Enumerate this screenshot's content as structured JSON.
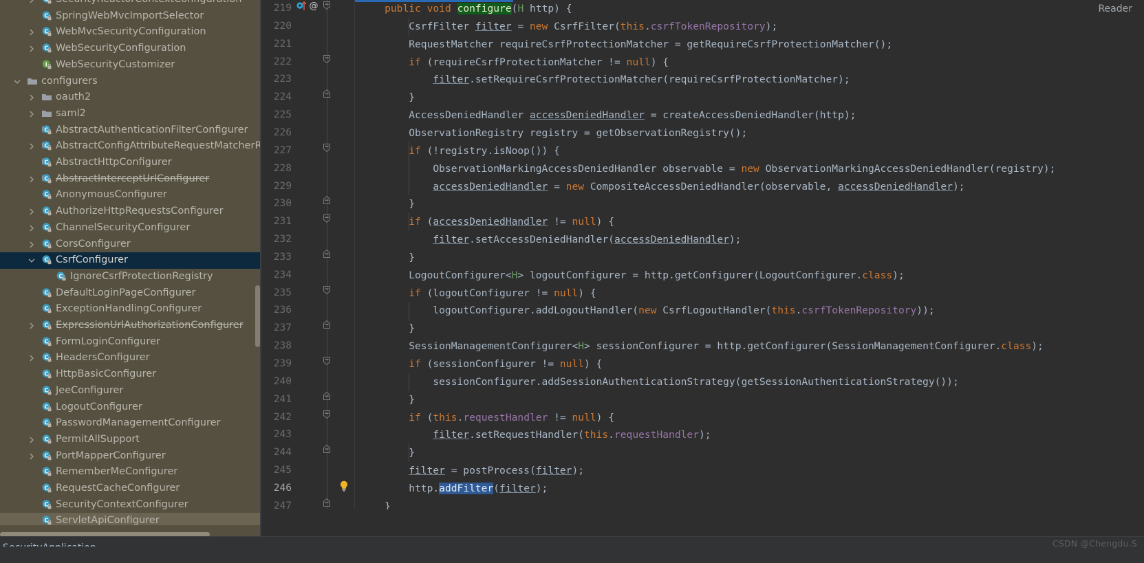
{
  "window": {
    "reader_label": "Reader",
    "watermark": "CSDN @Chengdu.S",
    "bottom_breadcrumb": "SecurityApplication"
  },
  "sidebar": {
    "scrollbar_h": "horizontal-scrollbar",
    "scrollbar_v": "vertical-scrollbar",
    "items": [
      {
        "label": "SecurityReactorContextConfiguration",
        "icon": "class-icon",
        "indent": 2,
        "arrow": "right",
        "state": "partial"
      },
      {
        "label": "SpringWebMvcImportSelector",
        "icon": "class-icon",
        "indent": 2,
        "arrow": "none"
      },
      {
        "label": "WebMvcSecurityConfiguration",
        "icon": "class-icon",
        "indent": 2,
        "arrow": "right"
      },
      {
        "label": "WebSecurityConfiguration",
        "icon": "class-icon",
        "indent": 2,
        "arrow": "right"
      },
      {
        "label": "WebSecurityCustomizer",
        "icon": "interface-icon",
        "indent": 2,
        "arrow": "none"
      },
      {
        "label": "configurers",
        "icon": "folder-icon",
        "indent": 1,
        "arrow": "down"
      },
      {
        "label": "oauth2",
        "icon": "folder-icon",
        "indent": 2,
        "arrow": "right"
      },
      {
        "label": "saml2",
        "icon": "folder-icon",
        "indent": 2,
        "arrow": "right"
      },
      {
        "label": "AbstractAuthenticationFilterConfigurer",
        "icon": "abstract-class-icon",
        "indent": 2,
        "arrow": "none"
      },
      {
        "label": "AbstractConfigAttributeRequestMatcherRegistry",
        "icon": "abstract-class-icon",
        "indent": 2,
        "arrow": "right"
      },
      {
        "label": "AbstractHttpConfigurer",
        "icon": "abstract-class-icon",
        "indent": 2,
        "arrow": "none"
      },
      {
        "label": "AbstractInterceptUrlConfigurer",
        "icon": "abstract-class-icon",
        "indent": 2,
        "arrow": "right",
        "deprecated": true
      },
      {
        "label": "AnonymousConfigurer",
        "icon": "class-icon",
        "indent": 2,
        "arrow": "none"
      },
      {
        "label": "AuthorizeHttpRequestsConfigurer",
        "icon": "class-icon",
        "indent": 2,
        "arrow": "right"
      },
      {
        "label": "ChannelSecurityConfigurer",
        "icon": "class-icon",
        "indent": 2,
        "arrow": "right"
      },
      {
        "label": "CorsConfigurer",
        "icon": "class-icon",
        "indent": 2,
        "arrow": "right"
      },
      {
        "label": "CsrfConfigurer",
        "icon": "class-icon",
        "indent": 2,
        "arrow": "down",
        "selected": true
      },
      {
        "label": "IgnoreCsrfProtectionRegistry",
        "icon": "class-icon",
        "indent": 3,
        "arrow": "none"
      },
      {
        "label": "DefaultLoginPageConfigurer",
        "icon": "class-icon",
        "indent": 2,
        "arrow": "none"
      },
      {
        "label": "ExceptionHandlingConfigurer",
        "icon": "class-icon",
        "indent": 2,
        "arrow": "none"
      },
      {
        "label": "ExpressionUrlAuthorizationConfigurer",
        "icon": "class-icon",
        "indent": 2,
        "arrow": "right",
        "deprecated": true
      },
      {
        "label": "FormLoginConfigurer",
        "icon": "class-icon",
        "indent": 2,
        "arrow": "none"
      },
      {
        "label": "HeadersConfigurer",
        "icon": "class-icon",
        "indent": 2,
        "arrow": "right"
      },
      {
        "label": "HttpBasicConfigurer",
        "icon": "class-icon",
        "indent": 2,
        "arrow": "none"
      },
      {
        "label": "JeeConfigurer",
        "icon": "class-icon",
        "indent": 2,
        "arrow": "none"
      },
      {
        "label": "LogoutConfigurer",
        "icon": "class-icon",
        "indent": 2,
        "arrow": "none"
      },
      {
        "label": "PasswordManagementConfigurer",
        "icon": "class-icon",
        "indent": 2,
        "arrow": "none"
      },
      {
        "label": "PermitAllSupport",
        "icon": "class-icon",
        "indent": 2,
        "arrow": "right"
      },
      {
        "label": "PortMapperConfigurer",
        "icon": "class-icon",
        "indent": 2,
        "arrow": "right"
      },
      {
        "label": "RememberMeConfigurer",
        "icon": "class-icon",
        "indent": 2,
        "arrow": "none"
      },
      {
        "label": "RequestCacheConfigurer",
        "icon": "class-icon",
        "indent": 2,
        "arrow": "none"
      },
      {
        "label": "SecurityContextConfigurer",
        "icon": "class-icon",
        "indent": 2,
        "arrow": "none"
      },
      {
        "label": "ServletApiConfigurer",
        "icon": "class-icon",
        "indent": 2,
        "arrow": "none",
        "ghost": true
      }
    ]
  },
  "editor": {
    "first_line_number": 219,
    "current_line_number": 246,
    "gutter_icons": {
      "override_method": "override-method-icon",
      "annotation": "annotation-icon",
      "intention_bulb": "intention-bulb-icon"
    },
    "find_highlight": "configure",
    "selection_highlight": "addFilter",
    "lines": [
      {
        "n": 219,
        "indent": 4,
        "fold": "start",
        "marks": [
          "override",
          "at"
        ],
        "tokens": [
          {
            "t": "public ",
            "c": "kw"
          },
          {
            "t": "void ",
            "c": "kw"
          },
          {
            "t": "configure",
            "c": "hl-find"
          },
          {
            "t": "(",
            "c": "plain"
          },
          {
            "t": "H",
            "c": "gen"
          },
          {
            "t": " http) {",
            "c": "plain"
          }
        ]
      },
      {
        "n": 220,
        "indent": 8,
        "tokens": [
          {
            "t": "CsrfFilter ",
            "c": "typ"
          },
          {
            "t": "filter",
            "c": "loc"
          },
          {
            "t": " = ",
            "c": "plain"
          },
          {
            "t": "new ",
            "c": "kw"
          },
          {
            "t": "CsrfFilter(",
            "c": "typ"
          },
          {
            "t": "this",
            "c": "kw"
          },
          {
            "t": ".",
            "c": "plain"
          },
          {
            "t": "csrfTokenRepository",
            "c": "fld"
          },
          {
            "t": ");",
            "c": "plain"
          }
        ]
      },
      {
        "n": 221,
        "indent": 8,
        "tokens": [
          {
            "t": "RequestMatcher requireCsrfProtectionMatcher = getRequireCsrfProtectionMatcher();",
            "c": "plain"
          }
        ]
      },
      {
        "n": 222,
        "indent": 8,
        "fold": "start",
        "tokens": [
          {
            "t": "if ",
            "c": "kw"
          },
          {
            "t": "(requireCsrfProtectionMatcher != ",
            "c": "plain"
          },
          {
            "t": "null",
            "c": "kw"
          },
          {
            "t": ") {",
            "c": "plain"
          }
        ]
      },
      {
        "n": 223,
        "indent": 12,
        "tokens": [
          {
            "t": "filter",
            "c": "loc"
          },
          {
            "t": ".setRequireCsrfProtectionMatcher(requireCsrfProtectionMatcher);",
            "c": "plain"
          }
        ]
      },
      {
        "n": 224,
        "indent": 8,
        "fold": "end",
        "tokens": [
          {
            "t": "}",
            "c": "plain"
          }
        ]
      },
      {
        "n": 225,
        "indent": 8,
        "tokens": [
          {
            "t": "AccessDeniedHandler ",
            "c": "typ"
          },
          {
            "t": "accessDeniedHandler",
            "c": "loc"
          },
          {
            "t": " = createAccessDeniedHandler(http);",
            "c": "plain"
          }
        ]
      },
      {
        "n": 226,
        "indent": 8,
        "tokens": [
          {
            "t": "ObservationRegistry registry = getObservationRegistry();",
            "c": "plain"
          }
        ]
      },
      {
        "n": 227,
        "indent": 8,
        "fold": "start",
        "tokens": [
          {
            "t": "if ",
            "c": "kw"
          },
          {
            "t": "(!registry.isNoop()) {",
            "c": "plain"
          }
        ]
      },
      {
        "n": 228,
        "indent": 12,
        "tokens": [
          {
            "t": "ObservationMarkingAccessDeniedHandler observable = ",
            "c": "plain"
          },
          {
            "t": "new ",
            "c": "kw"
          },
          {
            "t": "ObservationMarkingAccessDeniedHandler(registry);",
            "c": "plain"
          }
        ]
      },
      {
        "n": 229,
        "indent": 12,
        "tokens": [
          {
            "t": "accessDeniedHandler",
            "c": "loc"
          },
          {
            "t": " = ",
            "c": "plain"
          },
          {
            "t": "new ",
            "c": "kw"
          },
          {
            "t": "CompositeAccessDeniedHandler(observable, ",
            "c": "plain"
          },
          {
            "t": "accessDeniedHandler",
            "c": "loc"
          },
          {
            "t": ");",
            "c": "plain"
          }
        ]
      },
      {
        "n": 230,
        "indent": 8,
        "fold": "end",
        "tokens": [
          {
            "t": "}",
            "c": "plain"
          }
        ]
      },
      {
        "n": 231,
        "indent": 8,
        "fold": "start",
        "tokens": [
          {
            "t": "if ",
            "c": "kw"
          },
          {
            "t": "(",
            "c": "plain"
          },
          {
            "t": "accessDeniedHandler",
            "c": "loc"
          },
          {
            "t": " != ",
            "c": "plain"
          },
          {
            "t": "null",
            "c": "kw"
          },
          {
            "t": ") {",
            "c": "plain"
          }
        ]
      },
      {
        "n": 232,
        "indent": 12,
        "tokens": [
          {
            "t": "filter",
            "c": "loc"
          },
          {
            "t": ".setAccessDeniedHandler(",
            "c": "plain"
          },
          {
            "t": "accessDeniedHandler",
            "c": "loc"
          },
          {
            "t": ");",
            "c": "plain"
          }
        ]
      },
      {
        "n": 233,
        "indent": 8,
        "fold": "end",
        "tokens": [
          {
            "t": "}",
            "c": "plain"
          }
        ]
      },
      {
        "n": 234,
        "indent": 8,
        "tokens": [
          {
            "t": "LogoutConfigurer<",
            "c": "plain"
          },
          {
            "t": "H",
            "c": "gen"
          },
          {
            "t": "> logoutConfigurer = http.getConfigurer(LogoutConfigurer.",
            "c": "plain"
          },
          {
            "t": "class",
            "c": "kw"
          },
          {
            "t": ");",
            "c": "plain"
          }
        ]
      },
      {
        "n": 235,
        "indent": 8,
        "fold": "start",
        "tokens": [
          {
            "t": "if ",
            "c": "kw"
          },
          {
            "t": "(logoutConfigurer != ",
            "c": "plain"
          },
          {
            "t": "null",
            "c": "kw"
          },
          {
            "t": ") {",
            "c": "plain"
          }
        ]
      },
      {
        "n": 236,
        "indent": 12,
        "tokens": [
          {
            "t": "logoutConfigurer.addLogoutHandler(",
            "c": "plain"
          },
          {
            "t": "new ",
            "c": "kw"
          },
          {
            "t": "CsrfLogoutHandler(",
            "c": "plain"
          },
          {
            "t": "this",
            "c": "kw"
          },
          {
            "t": ".",
            "c": "plain"
          },
          {
            "t": "csrfTokenRepository",
            "c": "fld"
          },
          {
            "t": "));",
            "c": "plain"
          }
        ]
      },
      {
        "n": 237,
        "indent": 8,
        "fold": "end",
        "tokens": [
          {
            "t": "}",
            "c": "plain"
          }
        ]
      },
      {
        "n": 238,
        "indent": 8,
        "tokens": [
          {
            "t": "SessionManagementConfigurer<",
            "c": "plain"
          },
          {
            "t": "H",
            "c": "gen"
          },
          {
            "t": "> sessionConfigurer = http.getConfigurer(SessionManagementConfigurer.",
            "c": "plain"
          },
          {
            "t": "class",
            "c": "kw"
          },
          {
            "t": ");",
            "c": "plain"
          }
        ]
      },
      {
        "n": 239,
        "indent": 8,
        "fold": "start",
        "tokens": [
          {
            "t": "if ",
            "c": "kw"
          },
          {
            "t": "(sessionConfigurer != ",
            "c": "plain"
          },
          {
            "t": "null",
            "c": "kw"
          },
          {
            "t": ") {",
            "c": "plain"
          }
        ]
      },
      {
        "n": 240,
        "indent": 12,
        "tokens": [
          {
            "t": "sessionConfigurer.addSessionAuthenticationStrategy(getSessionAuthenticationStrategy());",
            "c": "plain"
          }
        ]
      },
      {
        "n": 241,
        "indent": 8,
        "fold": "end",
        "tokens": [
          {
            "t": "}",
            "c": "plain"
          }
        ]
      },
      {
        "n": 242,
        "indent": 8,
        "fold": "start",
        "tokens": [
          {
            "t": "if ",
            "c": "kw"
          },
          {
            "t": "(",
            "c": "plain"
          },
          {
            "t": "this",
            "c": "kw"
          },
          {
            "t": ".",
            "c": "plain"
          },
          {
            "t": "requestHandler",
            "c": "fld"
          },
          {
            "t": " != ",
            "c": "plain"
          },
          {
            "t": "null",
            "c": "kw"
          },
          {
            "t": ") {",
            "c": "plain"
          }
        ]
      },
      {
        "n": 243,
        "indent": 12,
        "tokens": [
          {
            "t": "filter",
            "c": "loc"
          },
          {
            "t": ".setRequestHandler(",
            "c": "plain"
          },
          {
            "t": "this",
            "c": "kw"
          },
          {
            "t": ".",
            "c": "plain"
          },
          {
            "t": "requestHandler",
            "c": "fld"
          },
          {
            "t": ");",
            "c": "plain"
          }
        ]
      },
      {
        "n": 244,
        "indent": 8,
        "fold": "end",
        "tokens": [
          {
            "t": "}",
            "c": "plain"
          }
        ]
      },
      {
        "n": 245,
        "indent": 8,
        "tokens": [
          {
            "t": "filter",
            "c": "loc"
          },
          {
            "t": " = postProcess(",
            "c": "plain"
          },
          {
            "t": "filter",
            "c": "loc"
          },
          {
            "t": ");",
            "c": "plain"
          }
        ]
      },
      {
        "n": 246,
        "indent": 8,
        "marks": [
          "bulb"
        ],
        "current": true,
        "tokens": [
          {
            "t": "http.",
            "c": "plain"
          },
          {
            "t": "addFilter",
            "c": "hl-sel"
          },
          {
            "t": "(",
            "c": "plain"
          },
          {
            "t": "filter",
            "c": "loc"
          },
          {
            "t": ");",
            "c": "plain"
          }
        ]
      },
      {
        "n": 247,
        "indent": 4,
        "fold": "end",
        "tokens": [
          {
            "t": "}",
            "c": "plain"
          }
        ]
      }
    ]
  },
  "colors": {
    "sidebar_bg": "#55503f",
    "editor_bg": "#2e2e2e",
    "selection_bg": "#0d293e",
    "find_highlight_bg": "#0f5c1b",
    "selection_text_bg": "#2f5a96",
    "keyword": "#cc7832",
    "field": "#9876aa",
    "generic": "#6a9a63",
    "default_text": "#a9b7c6",
    "line_number": "#6a6a6a"
  }
}
